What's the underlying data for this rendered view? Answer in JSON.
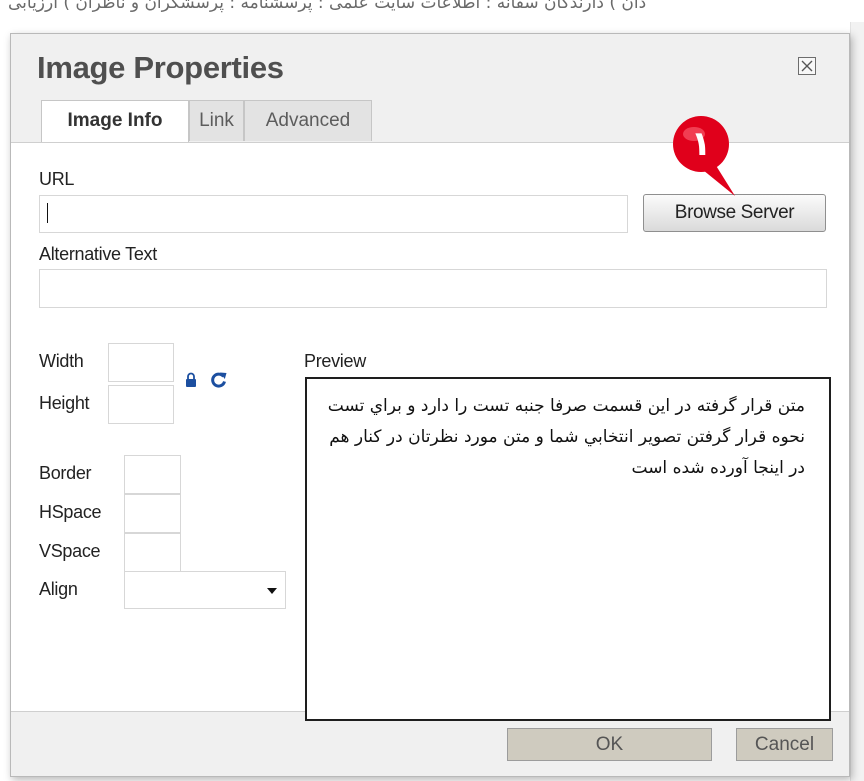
{
  "background": {
    "page_text": "دان ) دارندگان سفانه : اطلاعات سایت علمی : پرسشنامه : پرسشگران و ناظران ) ارزیابی"
  },
  "dialog": {
    "title": "Image Properties",
    "close_icon": "close-icon",
    "tabs": [
      {
        "label": "Image Info",
        "active": true
      },
      {
        "label": "Link",
        "active": false
      },
      {
        "label": "Advanced",
        "active": false
      }
    ],
    "url": {
      "label": "URL",
      "value": ""
    },
    "browse_button": "Browse Server",
    "alt_text": {
      "label": "Alternative Text",
      "value": ""
    },
    "width": {
      "label": "Width",
      "value": ""
    },
    "height": {
      "label": "Height",
      "value": ""
    },
    "lock_icon": "lock-icon",
    "reset_icon": "refresh-icon",
    "border": {
      "label": "Border",
      "value": ""
    },
    "hspace": {
      "label": "HSpace",
      "value": ""
    },
    "vspace": {
      "label": "VSpace",
      "value": ""
    },
    "align": {
      "label": "Align",
      "value": ""
    },
    "preview": {
      "label": "Preview",
      "text": "متن قرار گرفته در این قسمت صرفا جنبه تست را دارد و براي تست نحوه قرار گرفتن تصوير انتخابي شما و متن مورد نظرتان در كنار هم در اينجا آورده شده است"
    },
    "ok_button": "OK",
    "cancel_button": "Cancel"
  },
  "annotation": {
    "number": "۱",
    "color": "#e0001b"
  }
}
